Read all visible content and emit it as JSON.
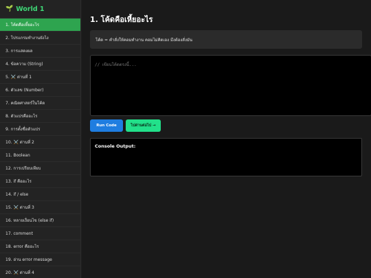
{
  "sidebar": {
    "world_icon": "seedling-icon",
    "world_title": "World 1",
    "items": [
      {
        "label": "1. โค้ดคือเหี้ยอะไร",
        "active": true
      },
      {
        "label": "2. โปรแกรมทำงานยังไง"
      },
      {
        "label": "3. การแสดงผล"
      },
      {
        "label": "4. ข้อความ (String)"
      },
      {
        "label": "5. ⚔️ ด่านที่ 1"
      },
      {
        "label": "6. ตัวเลข (Number)"
      },
      {
        "label": "7. คณิตศาสตร์ในโค้ด"
      },
      {
        "label": "8. ตัวแปรคืออะไร"
      },
      {
        "label": "9. การตั้งชื่อตัวแปร"
      },
      {
        "label": "10. ⚔️ ด่านที่ 2"
      },
      {
        "label": "11. Boolean"
      },
      {
        "label": "12. การเปรียบเทียบ"
      },
      {
        "label": "13. if คืออะไร"
      },
      {
        "label": "14. if / else"
      },
      {
        "label": "15. ⚔️ ด่านที่ 3"
      },
      {
        "label": "16. หลายเงื่อนไข (else if)"
      },
      {
        "label": "17. comment"
      },
      {
        "label": "18. error คืออะไร"
      },
      {
        "label": "19. อ่าน error message"
      },
      {
        "label": "20. ⚔️ ด่านที่ 4"
      }
    ]
  },
  "main": {
    "title": "1. โค้ดคือเหี้ยอะไร",
    "explanation": "โค้ด = คำสั่งให้คอมทำงาน คอมไม่คิดเอง มึงต้องสั่งมัน",
    "editor_placeholder": "// เขียนโค้ดตรงนี้...",
    "run_button": "Run Code",
    "next_button": "ไปด่านต่อไป →",
    "console_label": "Console Output:",
    "console_output": ""
  },
  "colors": {
    "accent_green": "#2ea44f",
    "title_green": "#3fd977",
    "run_blue": "#1f7de0",
    "next_green": "#22e08a"
  }
}
